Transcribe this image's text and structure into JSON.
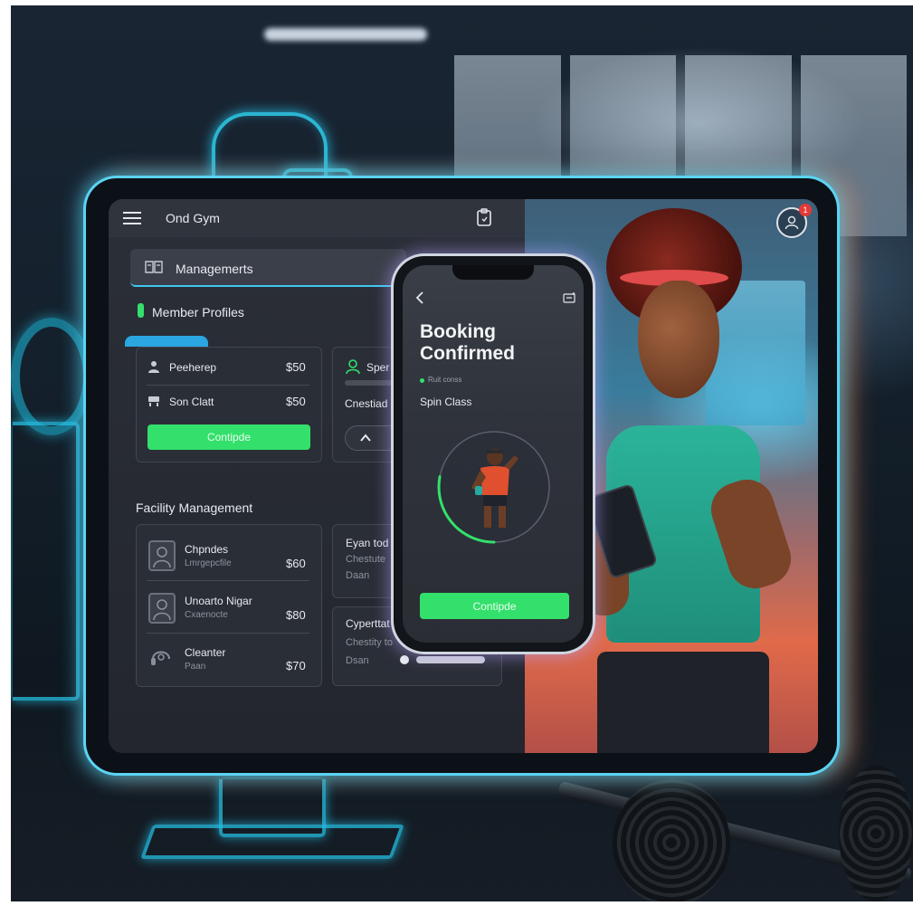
{
  "tablet": {
    "header": {
      "title": "Ond Gym",
      "menu_icon": "hamburger-icon",
      "action_icon": "clipboard-icon"
    },
    "profile": {
      "icon": "user-icon",
      "notification_count": "1",
      "badge_color": "#e53935"
    },
    "managements": {
      "label": "Managemerts",
      "icon": "book-icon"
    },
    "member_profiles": {
      "heading": "Member Profiles",
      "card1": {
        "rows": [
          {
            "icon": "person-icon",
            "label": "Peeherep",
            "price": "$50"
          },
          {
            "icon": "seat-icon",
            "label": "Son Clatt",
            "price": "$50"
          }
        ],
        "button": "Contipde"
      },
      "card2": {
        "title": "Sper",
        "subtitle": "Cnestiad d",
        "icon": "person-outline-icon",
        "chevron_icon": "chevron-up-icon"
      }
    },
    "facility": {
      "heading": "Facility Management",
      "rows": [
        {
          "icon": "portrait-icon",
          "name": "Chpndes",
          "sub": "Lmrgepcfile",
          "price": "$60"
        },
        {
          "icon": "portrait-icon",
          "name": "Unoarto Nigar",
          "sub": "Cxaenocte",
          "price": "$80"
        },
        {
          "icon": "headset-icon",
          "name": "Cleanter",
          "sub": "Paan",
          "price": "$70"
        }
      ],
      "card_b": {
        "title": "Eyan tod",
        "line1": "Chestute",
        "line2": "Daan"
      },
      "card_c": {
        "title": "Cyperttat",
        "line1": "Chestity to",
        "line2": "Dsan"
      }
    }
  },
  "phone": {
    "back_icon": "back-chevron-icon",
    "menu_icon": "menu-dots-icon",
    "title": "Booking Confirmed",
    "status": "Ruit conss",
    "class_name": "Spin Class",
    "button": "Contipde",
    "progress_fraction": 0.28
  },
  "colors": {
    "accent_green": "#33e06b",
    "neon_cyan": "#2fd0f0",
    "dark_ui": "#262a33"
  }
}
